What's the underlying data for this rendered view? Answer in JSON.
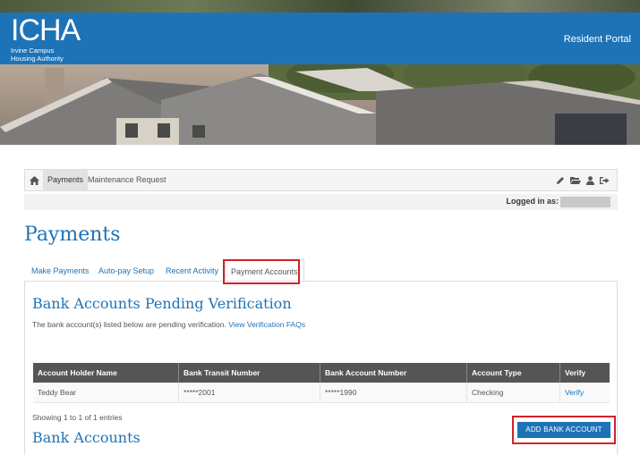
{
  "header": {
    "logo_mark": "ICHA",
    "logo_line1": "Irvine Campus",
    "logo_line2": "Housing Authority",
    "portal_label": "Resident Portal"
  },
  "nav": {
    "items": [
      {
        "label": "Payments",
        "active": true
      },
      {
        "label": "Maintenance Request",
        "active": false
      }
    ],
    "icons": [
      "pencil-icon",
      "folder-open-icon",
      "user-icon",
      "sign-out-icon"
    ]
  },
  "session": {
    "logged_in_label": "Logged in as:"
  },
  "page": {
    "title": "Payments"
  },
  "tabs": [
    {
      "label": "Make Payments",
      "active": false
    },
    {
      "label": "Auto-pay Setup",
      "active": false
    },
    {
      "label": "Recent Activity",
      "active": false
    },
    {
      "label": "Payment Accounts",
      "active": true
    }
  ],
  "pending": {
    "title": "Bank Accounts Pending Verification",
    "description": "The bank account(s) listed below are pending verification.",
    "faq_link": "View Verification FAQs",
    "columns": [
      "Account Holder Name",
      "Bank Transit Number",
      "Bank Account Number",
      "Account Type",
      "Verify"
    ],
    "rows": [
      {
        "holder": "Teddy Bear",
        "transit": "*****2001",
        "account": "*****1990",
        "type": "Checking",
        "verify": "Verify"
      }
    ],
    "entries_info": "Showing 1 to 1 of 1 entries"
  },
  "add_button_label": "ADD BANK ACCOUNT",
  "bank_accounts_title": "Bank Accounts",
  "colors": {
    "brand_blue": "#1e73b7",
    "highlight_red": "#d2232a",
    "table_header": "#555555"
  }
}
